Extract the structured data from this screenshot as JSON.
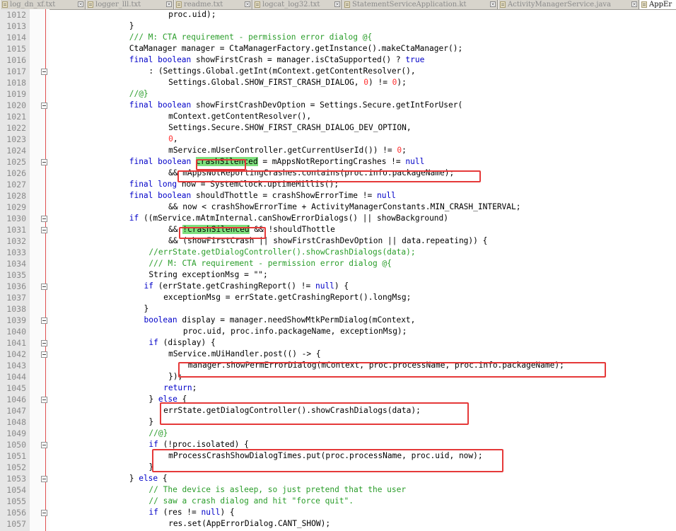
{
  "tabs": [
    {
      "label": "log_dn_xf.txt",
      "active": false
    },
    {
      "label": "logger_lll.txt",
      "active": false
    },
    {
      "label": "readme.txt",
      "active": false
    },
    {
      "label": "logcat_log32.txt",
      "active": false
    },
    {
      "label": "StatementServiceApplication.kt",
      "active": false
    },
    {
      "label": "ActivityManagerService.java",
      "active": false
    },
    {
      "label": "AppEr",
      "active": true
    }
  ],
  "icons": {
    "tab_file": "document-icon",
    "tab_close": "close-icon",
    "fold": "fold-collapse-icon"
  },
  "colors": {
    "keyword": "#0000c8",
    "comment": "#2a9d2a",
    "number": "#ff3030",
    "highlight": "#7ee07e",
    "annotation_box": "#e53939"
  },
  "lines": [
    {
      "n": "1012",
      "fold": false,
      "indent": 24,
      "parts": [
        {
          "t": "proc.uid);"
        }
      ]
    },
    {
      "n": "1013",
      "fold": false,
      "indent": 16,
      "parts": [
        {
          "t": "}"
        }
      ]
    },
    {
      "n": "1014",
      "fold": false,
      "indent": 16,
      "parts": [
        {
          "t": "/// M: CTA requirement - permission error dialog @{",
          "c": "cm"
        }
      ]
    },
    {
      "n": "1015",
      "fold": false,
      "indent": 16,
      "parts": [
        {
          "t": "CtaManager manager = CtaManagerFactory.getInstance().makeCtaManager();"
        }
      ]
    },
    {
      "n": "1016",
      "fold": false,
      "indent": 16,
      "parts": [
        {
          "t": "final boolean",
          "c": "kw"
        },
        {
          "t": " showFirstCrash = manager.isCtaSupported() ? "
        },
        {
          "t": "true",
          "c": "kw"
        }
      ]
    },
    {
      "n": "1017",
      "fold": true,
      "indent": 20,
      "parts": [
        {
          "t": ": (Settings.Global.getInt(mContext.getContentResolver(),"
        }
      ]
    },
    {
      "n": "1018",
      "fold": false,
      "indent": 24,
      "parts": [
        {
          "t": "Settings.Global.SHOW_FIRST_CRASH_DIALOG, "
        },
        {
          "t": "0",
          "c": "num"
        },
        {
          "t": ") != "
        },
        {
          "t": "0",
          "c": "num"
        },
        {
          "t": ");"
        }
      ]
    },
    {
      "n": "1019",
      "fold": false,
      "indent": 16,
      "parts": [
        {
          "t": "//@}",
          "c": "cm"
        }
      ]
    },
    {
      "n": "1020",
      "fold": true,
      "indent": 16,
      "parts": [
        {
          "t": "final boolean",
          "c": "kw"
        },
        {
          "t": " showFirstCrashDevOption = Settings.Secure.getIntForUser("
        }
      ]
    },
    {
      "n": "1021",
      "fold": false,
      "indent": 24,
      "parts": [
        {
          "t": "mContext.getContentResolver(),"
        }
      ]
    },
    {
      "n": "1022",
      "fold": false,
      "indent": 24,
      "parts": [
        {
          "t": "Settings.Secure.SHOW_FIRST_CRASH_DIALOG_DEV_OPTION,"
        }
      ]
    },
    {
      "n": "1023",
      "fold": false,
      "indent": 24,
      "parts": [
        {
          "t": "0",
          "c": "num"
        },
        {
          "t": ","
        }
      ]
    },
    {
      "n": "1024",
      "fold": false,
      "indent": 24,
      "parts": [
        {
          "t": "mService.mUserController.getCurrentUserId()) != "
        },
        {
          "t": "0",
          "c": "num"
        },
        {
          "t": ";"
        }
      ]
    },
    {
      "n": "1025",
      "fold": true,
      "indent": 16,
      "parts": [
        {
          "t": "final boolean",
          "c": "kw"
        },
        {
          "t": " "
        },
        {
          "t": "crashSilenced",
          "c": "hl"
        },
        {
          "t": " = mAppsNotReportingCrashes != "
        },
        {
          "t": "null",
          "c": "kw"
        }
      ]
    },
    {
      "n": "1026",
      "fold": false,
      "indent": 24,
      "parts": [
        {
          "t": "&& mAppsNotReportingCrashes.contains(proc.info.packageName);"
        }
      ]
    },
    {
      "n": "1027",
      "fold": false,
      "indent": 16,
      "parts": [
        {
          "t": "final long",
          "c": "kw"
        },
        {
          "t": " now = SystemClock.uptimeMillis();"
        }
      ]
    },
    {
      "n": "1028",
      "fold": false,
      "indent": 16,
      "parts": [
        {
          "t": "final boolean",
          "c": "kw"
        },
        {
          "t": " shouldThottle = crashShowErrorTime != "
        },
        {
          "t": "null",
          "c": "kw"
        }
      ]
    },
    {
      "n": "1029",
      "fold": false,
      "indent": 24,
      "parts": [
        {
          "t": "&& now < crashShowErrorTime + ActivityManagerConstants.MIN_CRASH_INTERVAL;"
        }
      ]
    },
    {
      "n": "1030",
      "fold": true,
      "indent": 16,
      "parts": [
        {
          "t": "if",
          "c": "kw"
        },
        {
          "t": " ((mService.mAtmInternal.canShowErrorDialogs() || showBackground)"
        }
      ]
    },
    {
      "n": "1031",
      "fold": true,
      "indent": 24,
      "parts": [
        {
          "t": "&& "
        },
        {
          "t": "!crashSilenced",
          "c": "hl"
        },
        {
          "t": " && !shouldThottle"
        }
      ]
    },
    {
      "n": "1032",
      "fold": false,
      "indent": 24,
      "parts": [
        {
          "t": "&& (showFirstCrash || showFirstCrashDevOption || data.repeating)) {"
        }
      ]
    },
    {
      "n": "1033",
      "fold": false,
      "indent": 20,
      "parts": [
        {
          "t": "//errState.getDialogController().showCrashDialogs(data);",
          "c": "cm"
        }
      ]
    },
    {
      "n": "1034",
      "fold": false,
      "indent": 20,
      "parts": [
        {
          "t": "/// M: CTA requirement - permission error dialog @{",
          "c": "cm"
        }
      ]
    },
    {
      "n": "1035",
      "fold": false,
      "indent": 20,
      "parts": [
        {
          "t": "String exceptionMsg = \"\";"
        }
      ]
    },
    {
      "n": "1036",
      "fold": true,
      "indent": 19,
      "parts": [
        {
          "t": "if",
          "c": "kw"
        },
        {
          "t": " (errState.getCrashingReport() != "
        },
        {
          "t": "null",
          "c": "kw"
        },
        {
          "t": ") {"
        }
      ]
    },
    {
      "n": "1037",
      "fold": false,
      "indent": 23,
      "parts": [
        {
          "t": "exceptionMsg = errState.getCrashingReport().longMsg;"
        }
      ]
    },
    {
      "n": "1038",
      "fold": false,
      "indent": 19,
      "parts": [
        {
          "t": "}"
        }
      ]
    },
    {
      "n": "1039",
      "fold": true,
      "indent": 19,
      "parts": [
        {
          "t": "boolean",
          "c": "kw"
        },
        {
          "t": " display = manager.needShowMtkPermDialog(mContext,"
        }
      ]
    },
    {
      "n": "1040",
      "fold": false,
      "indent": 27,
      "parts": [
        {
          "t": "proc.uid, proc.info.packageName, exceptionMsg);"
        }
      ]
    },
    {
      "n": "1041",
      "fold": true,
      "indent": 20,
      "parts": [
        {
          "t": "if",
          "c": "kw"
        },
        {
          "t": " (display) {"
        }
      ]
    },
    {
      "n": "1042",
      "fold": true,
      "indent": 24,
      "parts": [
        {
          "t": "mService.mUiHandler.post(() -> {"
        }
      ]
    },
    {
      "n": "1043",
      "fold": false,
      "indent": 28,
      "parts": [
        {
          "t": "manager.showPermErrorDialog(mContext, proc.processName, proc.info.packageName);"
        }
      ]
    },
    {
      "n": "1044",
      "fold": false,
      "indent": 24,
      "parts": [
        {
          "t": "});"
        }
      ]
    },
    {
      "n": "1045",
      "fold": false,
      "indent": 23,
      "parts": [
        {
          "t": "return",
          "c": "kw"
        },
        {
          "t": ";"
        }
      ]
    },
    {
      "n": "1046",
      "fold": true,
      "indent": 20,
      "parts": [
        {
          "t": "} "
        },
        {
          "t": "else",
          "c": "kw"
        },
        {
          "t": " {"
        }
      ]
    },
    {
      "n": "1047",
      "fold": false,
      "indent": 23,
      "parts": [
        {
          "t": "errState.getDialogController().showCrashDialogs(data);"
        }
      ]
    },
    {
      "n": "1048",
      "fold": false,
      "indent": 20,
      "parts": [
        {
          "t": "}"
        }
      ]
    },
    {
      "n": "1049",
      "fold": false,
      "indent": 20,
      "parts": [
        {
          "t": "//@}",
          "c": "cm"
        }
      ]
    },
    {
      "n": "1050",
      "fold": true,
      "indent": 20,
      "parts": [
        {
          "t": "if",
          "c": "kw"
        },
        {
          "t": " (!proc.isolated) {"
        }
      ]
    },
    {
      "n": "1051",
      "fold": false,
      "indent": 24,
      "parts": [
        {
          "t": "mProcessCrashShowDialogTimes.put(proc.processName, proc.uid, now);"
        }
      ]
    },
    {
      "n": "1052",
      "fold": false,
      "indent": 20,
      "parts": [
        {
          "t": "}"
        }
      ]
    },
    {
      "n": "1053",
      "fold": true,
      "indent": 16,
      "parts": [
        {
          "t": "} "
        },
        {
          "t": "else",
          "c": "kw"
        },
        {
          "t": " {"
        }
      ]
    },
    {
      "n": "1054",
      "fold": false,
      "indent": 20,
      "parts": [
        {
          "t": "// The device is asleep, so just pretend that the user",
          "c": "cm"
        }
      ]
    },
    {
      "n": "1055",
      "fold": false,
      "indent": 20,
      "parts": [
        {
          "t": "// saw a crash dialog and hit \"force quit\".",
          "c": "cm"
        }
      ]
    },
    {
      "n": "1056",
      "fold": true,
      "indent": 20,
      "parts": [
        {
          "t": "if",
          "c": "kw"
        },
        {
          "t": " (res != "
        },
        {
          "t": "null",
          "c": "kw"
        },
        {
          "t": ") {"
        }
      ]
    },
    {
      "n": "1057",
      "fold": false,
      "indent": 24,
      "parts": [
        {
          "t": "res.set(AppErrorDialog.CANT_SHOW);"
        }
      ]
    }
  ]
}
